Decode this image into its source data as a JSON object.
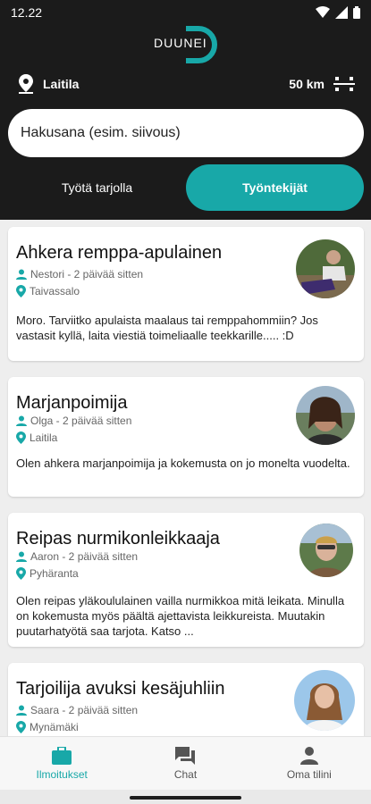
{
  "status_bar": {
    "time": "12.22"
  },
  "app": {
    "logo_text": "DUUNEI"
  },
  "location": {
    "name": "Laitila",
    "radius": "50 km"
  },
  "search": {
    "placeholder": "Hakusana (esim. siivous)"
  },
  "tabs": [
    {
      "label": "Työtä tarjolla",
      "active": false
    },
    {
      "label": "Työntekijät",
      "active": true
    }
  ],
  "listings": [
    {
      "title": "Ahkera remppa-apulainen",
      "author_time": "Nestori - 2 päivää sitten",
      "location": "Taivassalo",
      "description": "Moro. Tarviitko apulaista maalaus tai remppahommiin? Jos vastasit kyllä, laita viestiä toimeliaalle teekkarille..... :D"
    },
    {
      "title": " Marjanpoimija",
      "author_time": "Olga - 2 päivää sitten",
      "location": "Laitila",
      "description": "Olen ahkera marjanpoimija ja kokemusta on jo monelta vuodelta."
    },
    {
      "title": "Reipas nurmikonleikkaaja",
      "author_time": "Aaron - 2 päivää sitten",
      "location": "Pyhäranta",
      "description": "Olen reipas yläkoululainen vailla nurmikkoa mitä leikata. Minulla on kokemusta myös päältä ajettavista leikkureista. Muutakin puutarhatyötä saa tarjota. Katso ..."
    },
    {
      "title": "Tarjoilija avuksi kesäjuhliin",
      "author_time": "Saara - 2 päivää sitten",
      "location": "Mynämäki",
      "description": ""
    }
  ],
  "bottom_nav": [
    {
      "label": "Ilmoitukset",
      "icon": "briefcase-icon",
      "active": true
    },
    {
      "label": "Chat",
      "icon": "chat-icon",
      "active": false
    },
    {
      "label": "Oma tilini",
      "icon": "person-icon",
      "active": false
    }
  ],
  "colors": {
    "accent": "#18a8a8",
    "header_bg": "#1b1b1b",
    "background": "#eeeeee"
  }
}
